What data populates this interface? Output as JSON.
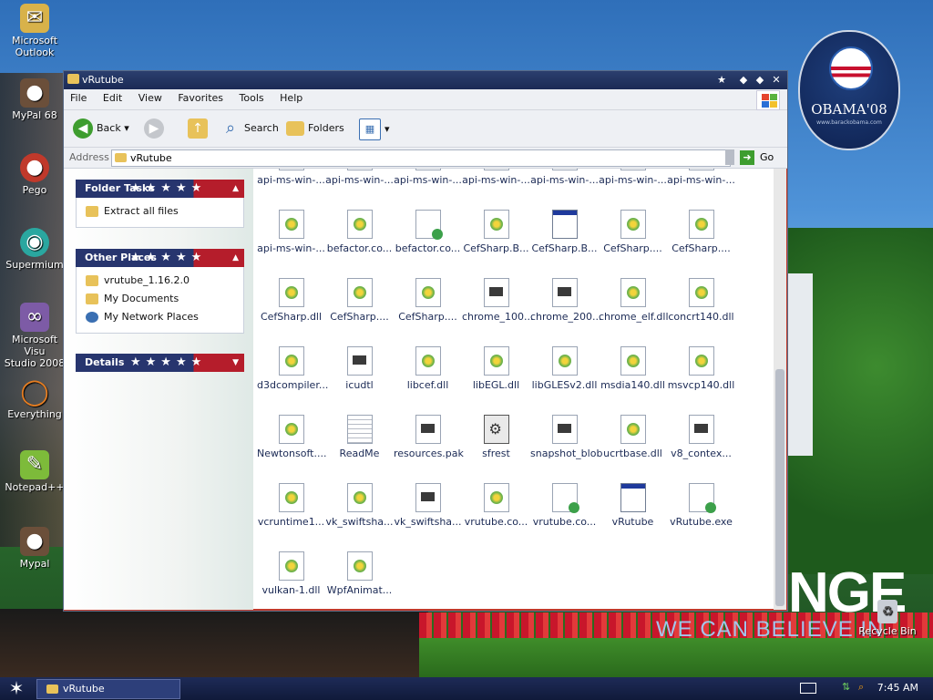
{
  "desktop": {
    "icons": [
      {
        "label": "Microsoft\nOutlook",
        "icon": "outlook-icon",
        "color": "#d8b24a"
      },
      {
        "label": "MyPal 68",
        "icon": "mypal-icon",
        "color": "#6b4f3a"
      },
      {
        "label": "Pego",
        "icon": "pego-icon",
        "color": "#c0392b"
      },
      {
        "label": "Supermium",
        "icon": "supermium-icon",
        "color": "#2aa7a0"
      },
      {
        "label": "Microsoft Visu\nStudio 2008",
        "icon": "visual-studio-icon",
        "color": "#7d5ba6"
      },
      {
        "label": "Everything",
        "icon": "everything-icon",
        "color": "#e67e22"
      },
      {
        "label": "Notepad++",
        "icon": "notepadpp-icon",
        "color": "#7dbb3a"
      },
      {
        "label": "Mypal",
        "icon": "mypal-icon",
        "color": "#6b4f3a"
      }
    ],
    "recycle_bin": "Recycle Bin",
    "wallpaper": {
      "badge_text": "OBAMA'08",
      "badge_sub": "www.barackobama.com",
      "slogan_big": "NGE",
      "slogan_small": "WE CAN BELIEVE IN"
    }
  },
  "window": {
    "title": "vRutube",
    "menu": [
      "File",
      "Edit",
      "View",
      "Favorites",
      "Tools",
      "Help"
    ],
    "toolbar": {
      "back": "Back",
      "search": "Search",
      "folders": "Folders"
    },
    "address": {
      "label": "Address",
      "value": "vRutube",
      "go": "Go"
    },
    "panels": {
      "folder_tasks": {
        "title": "Folder Tasks",
        "items": [
          "Extract all files"
        ]
      },
      "other_places": {
        "title": "Other Places",
        "items": [
          "vrutube_1.16.2.0",
          "My Documents",
          "My Network Places"
        ]
      },
      "details": {
        "title": "Details"
      }
    },
    "files": [
      {
        "name": "api-ms-win-...",
        "type": "dll"
      },
      {
        "name": "api-ms-win-...",
        "type": "dll"
      },
      {
        "name": "api-ms-win-...",
        "type": "dll"
      },
      {
        "name": "api-ms-win-...",
        "type": "dll"
      },
      {
        "name": "api-ms-win-...",
        "type": "dll"
      },
      {
        "name": "api-ms-win-...",
        "type": "dll"
      },
      {
        "name": "api-ms-win-...",
        "type": "dll"
      },
      {
        "name": "api-ms-win-...",
        "type": "dll"
      },
      {
        "name": "befactor.co...",
        "type": "dll"
      },
      {
        "name": "befactor.co...",
        "type": "exe"
      },
      {
        "name": "CefSharp.B...",
        "type": "dll"
      },
      {
        "name": "CefSharp.B...",
        "type": "app"
      },
      {
        "name": "CefSharp....",
        "type": "dll"
      },
      {
        "name": "CefSharp....",
        "type": "dll"
      },
      {
        "name": "CefSharp.dll",
        "type": "dll"
      },
      {
        "name": "CefSharp....",
        "type": "dll"
      },
      {
        "name": "CefSharp....",
        "type": "dll"
      },
      {
        "name": "chrome_100...",
        "type": "doc"
      },
      {
        "name": "chrome_200...",
        "type": "doc"
      },
      {
        "name": "chrome_elf.dll",
        "type": "dll"
      },
      {
        "name": "concrt140.dll",
        "type": "dll"
      },
      {
        "name": "d3dcompiler...",
        "type": "dll"
      },
      {
        "name": "icudtl",
        "type": "doc"
      },
      {
        "name": "libcef.dll",
        "type": "dll"
      },
      {
        "name": "libEGL.dll",
        "type": "dll"
      },
      {
        "name": "libGLESv2.dll",
        "type": "dll"
      },
      {
        "name": "msdia140.dll",
        "type": "dll"
      },
      {
        "name": "msvcp140.dll",
        "type": "dll"
      },
      {
        "name": "Newtonsoft....",
        "type": "dll"
      },
      {
        "name": "ReadMe",
        "type": "txt"
      },
      {
        "name": "resources.pak",
        "type": "doc"
      },
      {
        "name": "sfrest",
        "type": "gear"
      },
      {
        "name": "snapshot_blob",
        "type": "doc"
      },
      {
        "name": "ucrtbase.dll",
        "type": "dll"
      },
      {
        "name": "v8_contex...",
        "type": "doc"
      },
      {
        "name": "vcruntime1...",
        "type": "dll"
      },
      {
        "name": "vk_swiftsha...",
        "type": "dll"
      },
      {
        "name": "vk_swiftsha...",
        "type": "doc"
      },
      {
        "name": "vrutube.co...",
        "type": "dll"
      },
      {
        "name": "vrutube.co...",
        "type": "exe"
      },
      {
        "name": "vRutube",
        "type": "app"
      },
      {
        "name": "vRutube.exe",
        "type": "exe"
      },
      {
        "name": "vulkan-1.dll",
        "type": "dll"
      },
      {
        "name": "WpfAnimat...",
        "type": "dll"
      }
    ]
  },
  "taskbar": {
    "task": "vRutube",
    "clock": "7:45 AM"
  },
  "colors": {
    "title_bg": "#1b2a55",
    "panel_blue": "#27356e",
    "panel_red": "#b51d2b"
  }
}
